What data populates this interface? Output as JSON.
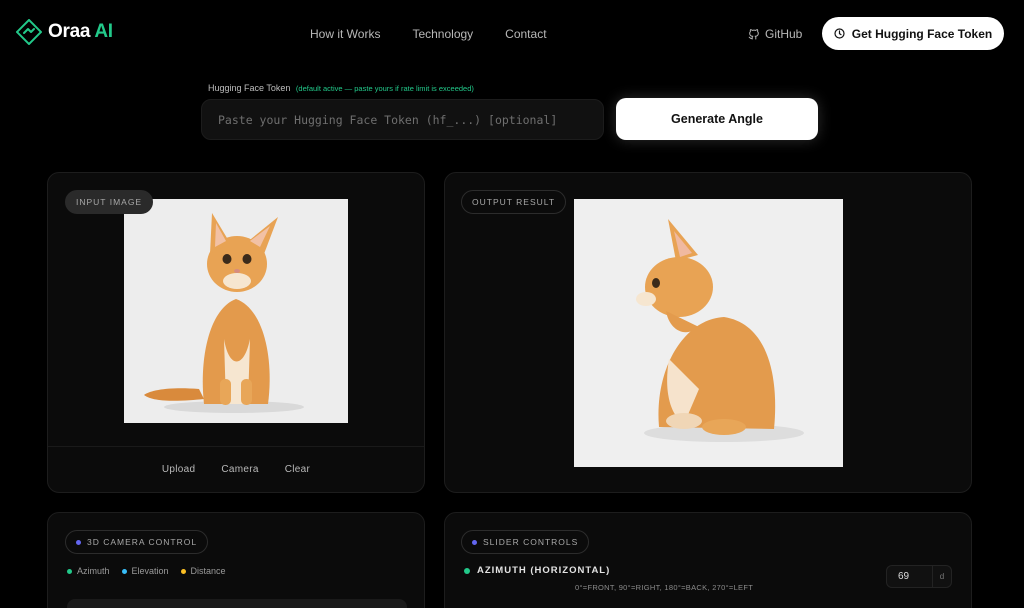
{
  "brand": {
    "name_main": "Oraa",
    "name_accent": "AI"
  },
  "nav": {
    "items": [
      "How it Works",
      "Technology",
      "Contact"
    ]
  },
  "header": {
    "github_label": "GitHub",
    "token_button_label": "Get Hugging Face Token"
  },
  "token": {
    "label": "Hugging Face Token",
    "hint": "(default active — paste yours if rate limit is exceeded)",
    "placeholder": "Paste your Hugging Face Token (hf_...) [optional]",
    "value": ""
  },
  "generate_button_label": "Generate Angle",
  "input_panel": {
    "badge": "INPUT IMAGE",
    "image_subject": "orange kitten, front view",
    "actions": [
      "Upload",
      "Camera",
      "Clear"
    ]
  },
  "output_panel": {
    "badge": "OUTPUT RESULT",
    "image_subject": "orange kitten, side view"
  },
  "camera_panel": {
    "badge": "3D CAMERA CONTROL",
    "legend": [
      {
        "label": "Azimuth",
        "color": "#22c98a"
      },
      {
        "label": "Elevation",
        "color": "#38bdf8"
      },
      {
        "label": "Distance",
        "color": "#fbbf24"
      }
    ]
  },
  "slider_panel": {
    "badge": "SLIDER CONTROLS",
    "azimuth": {
      "title": "AZIMUTH (HORIZONTAL)",
      "description": "0°=FRONT, 90°=RIGHT, 180°=BACK, 270°=LEFT",
      "value": "69",
      "unit": "d"
    }
  },
  "colors": {
    "accent": "#22c98a",
    "badge_dot": "#6366f1"
  }
}
